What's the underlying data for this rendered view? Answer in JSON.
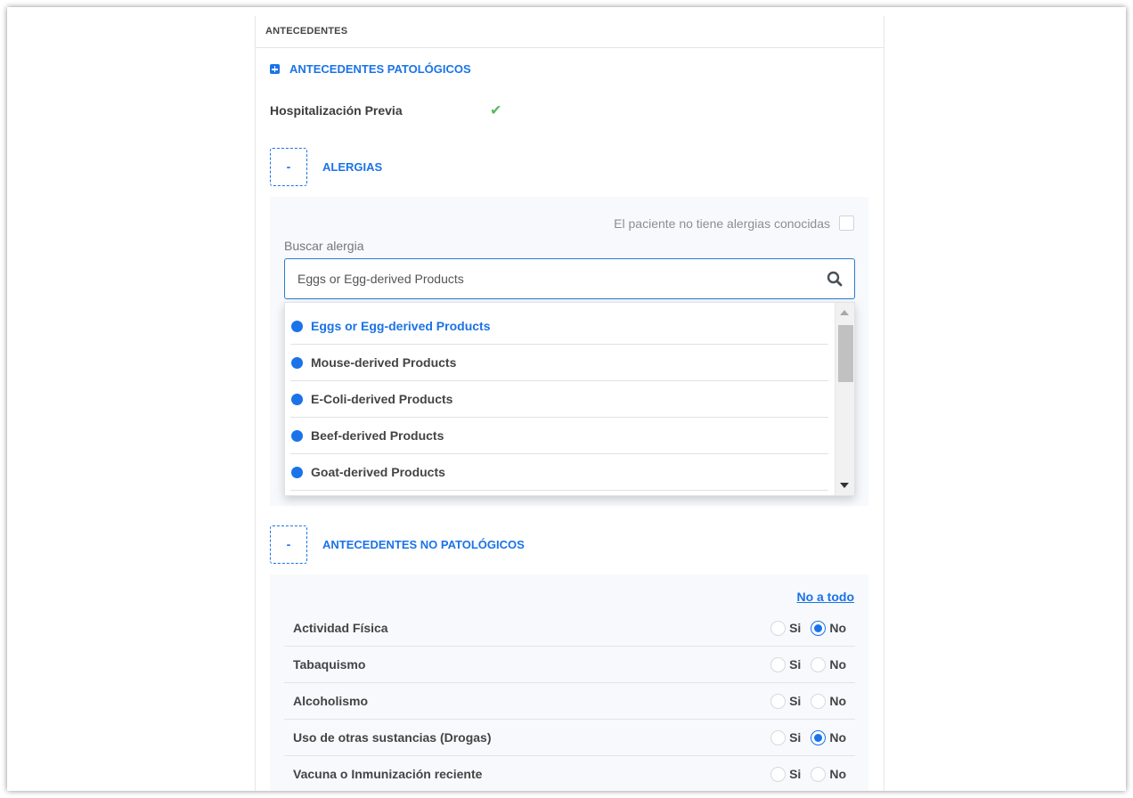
{
  "panel": {
    "header": "ANTECEDENTES"
  },
  "patologicos": {
    "title": "ANTECEDENTES PATOLÓGICOS"
  },
  "hospitalizacion": {
    "label": "Hospitalización Previa",
    "check": "✔"
  },
  "alergias": {
    "toggle": "-",
    "title": "ALERGIAS",
    "no_known_label": "El paciente no tiene alergias conocidas",
    "search_label": "Buscar alergia",
    "search_value": "Eggs or Egg-derived Products",
    "results": [
      "Eggs or Egg-derived Products",
      "Mouse-derived Products",
      "E-Coli-derived Products",
      "Beef-derived Products",
      "Goat-derived Products"
    ]
  },
  "no_patologicos": {
    "toggle": "-",
    "title": "ANTECEDENTES NO PATOLÓGICOS",
    "no_a_todo": "No a todo",
    "yes_label": "Si",
    "no_label": "No",
    "questions": [
      {
        "label": "Actividad Física",
        "answer": "No"
      },
      {
        "label": "Tabaquismo",
        "answer": ""
      },
      {
        "label": "Alcoholismo",
        "answer": ""
      },
      {
        "label": "Uso de otras sustancias (Drogas)",
        "answer": "No"
      },
      {
        "label": "Vacuna o Inmunización reciente",
        "answer": ""
      }
    ]
  },
  "colors": {
    "accent": "#1a73e8",
    "check": "#5cb85c"
  }
}
